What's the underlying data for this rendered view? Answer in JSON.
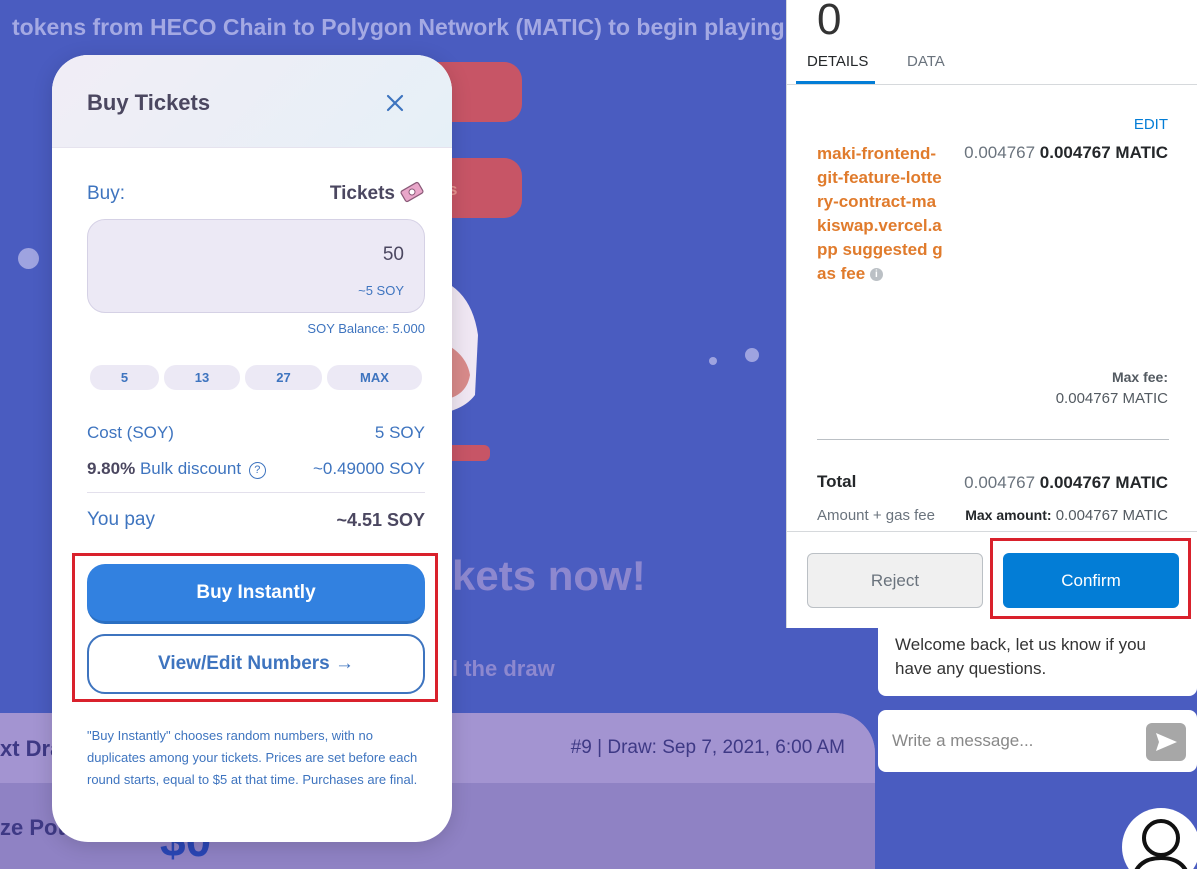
{
  "background": {
    "top_text": "tokens from HECO Chain to Polygon Network (MATIC) to begin playing",
    "button_fragment": "s",
    "heading_fragment": "kets now!",
    "sub_fragment": "l the draw",
    "card_left": "xt Dra",
    "card_right": "#9 | Draw: Sep 7, 2021, 6:00 AM",
    "prize_label": "ze Pot",
    "prize_value": "$0"
  },
  "buy_modal": {
    "title": "Buy Tickets",
    "buy_label": "Buy:",
    "tickets_label": "Tickets",
    "amount_value": "50",
    "amount_soy": "~5 SOY",
    "balance": "SOY Balance: 5.000",
    "quick_options": [
      "5",
      "13",
      "27",
      "MAX"
    ],
    "cost_label": "Cost (SOY)",
    "cost_value": "5 SOY",
    "discount_percent": "9.80%",
    "discount_label": "Bulk discount",
    "discount_value": "~0.49000 SOY",
    "you_pay_label": "You pay",
    "you_pay_value": "~4.51 SOY",
    "buy_instantly": "Buy Instantly",
    "view_edit": "View/Edit Numbers →",
    "note": "\"Buy Instantly\" chooses random numbers, with no duplicates among your tickets. Prices are set before each round starts, equal to $5 at that time. Purchases are final."
  },
  "metamask": {
    "top_number": "0",
    "tabs": [
      "DETAILS",
      "DATA"
    ],
    "edit": "EDIT",
    "site_label": "maki-frontend-git-feature-lottery-contract-makiswap.vercel.app suggested gas fee",
    "fee_light": "0.004767",
    "fee_strong": "0.004767 MATIC",
    "max_fee_label": "Max fee:",
    "max_fee_value": "0.004767 MATIC",
    "total_label": "Total",
    "total_light": "0.004767",
    "total_strong": "0.004767 MATIC",
    "gas_label": "Amount + gas fee",
    "max_amount_label": "Max amount:",
    "max_amount_value": "0.004767 MATIC",
    "reject": "Reject",
    "confirm": "Confirm"
  },
  "chat": {
    "message": "Welcome back, let us know if you have any questions.",
    "placeholder": "Write a message..."
  }
}
